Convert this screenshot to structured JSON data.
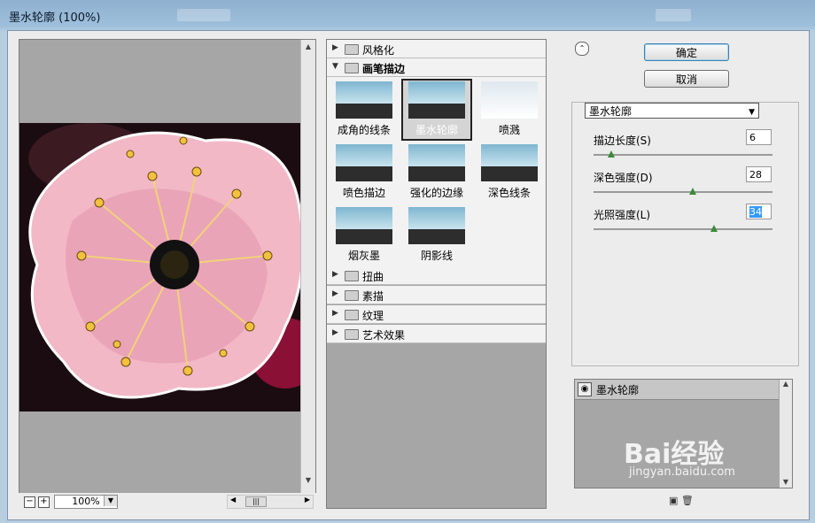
{
  "window": {
    "title": "墨水轮廓 (100%)"
  },
  "preview": {
    "zoom": "100%",
    "zoom_out_label": "−",
    "zoom_in_label": "+"
  },
  "filter_gallery": {
    "categories_top": [
      {
        "label": "风格化",
        "expanded": false
      },
      {
        "label": "画笔描边",
        "expanded": true
      }
    ],
    "thumbnails": [
      {
        "label": "成角的线条",
        "selected": false
      },
      {
        "label": "墨水轮廓",
        "selected": true
      },
      {
        "label": "喷溅",
        "selected": false
      },
      {
        "label": "喷色描边",
        "selected": false
      },
      {
        "label": "强化的边缘",
        "selected": false
      },
      {
        "label": "深色线条",
        "selected": false
      },
      {
        "label": "烟灰墨",
        "selected": false
      },
      {
        "label": "阴影线",
        "selected": false
      }
    ],
    "categories_bottom": [
      {
        "label": "扭曲"
      },
      {
        "label": "素描"
      },
      {
        "label": "纹理"
      },
      {
        "label": "艺术效果"
      }
    ]
  },
  "buttons": {
    "ok": "确定",
    "cancel": "取消"
  },
  "params": {
    "filter_select": "墨水轮廓",
    "stroke_length": {
      "label": "描边长度(S)",
      "value": "6",
      "fraction": 0.1
    },
    "dark_intensity": {
      "label": "深色强度(D)",
      "value": "28",
      "fraction": 0.56
    },
    "light_intensity": {
      "label": "光照强度(L)",
      "value": "34",
      "fraction": 0.68
    }
  },
  "layers": {
    "items": [
      {
        "label": "墨水轮廓",
        "visible": true
      }
    ]
  },
  "watermark": {
    "brand": "Bai经验",
    "url": "jingyan.baidu.com"
  },
  "colors": {
    "selection": "#3399ff",
    "slider_knob": "#3a8a3a"
  }
}
